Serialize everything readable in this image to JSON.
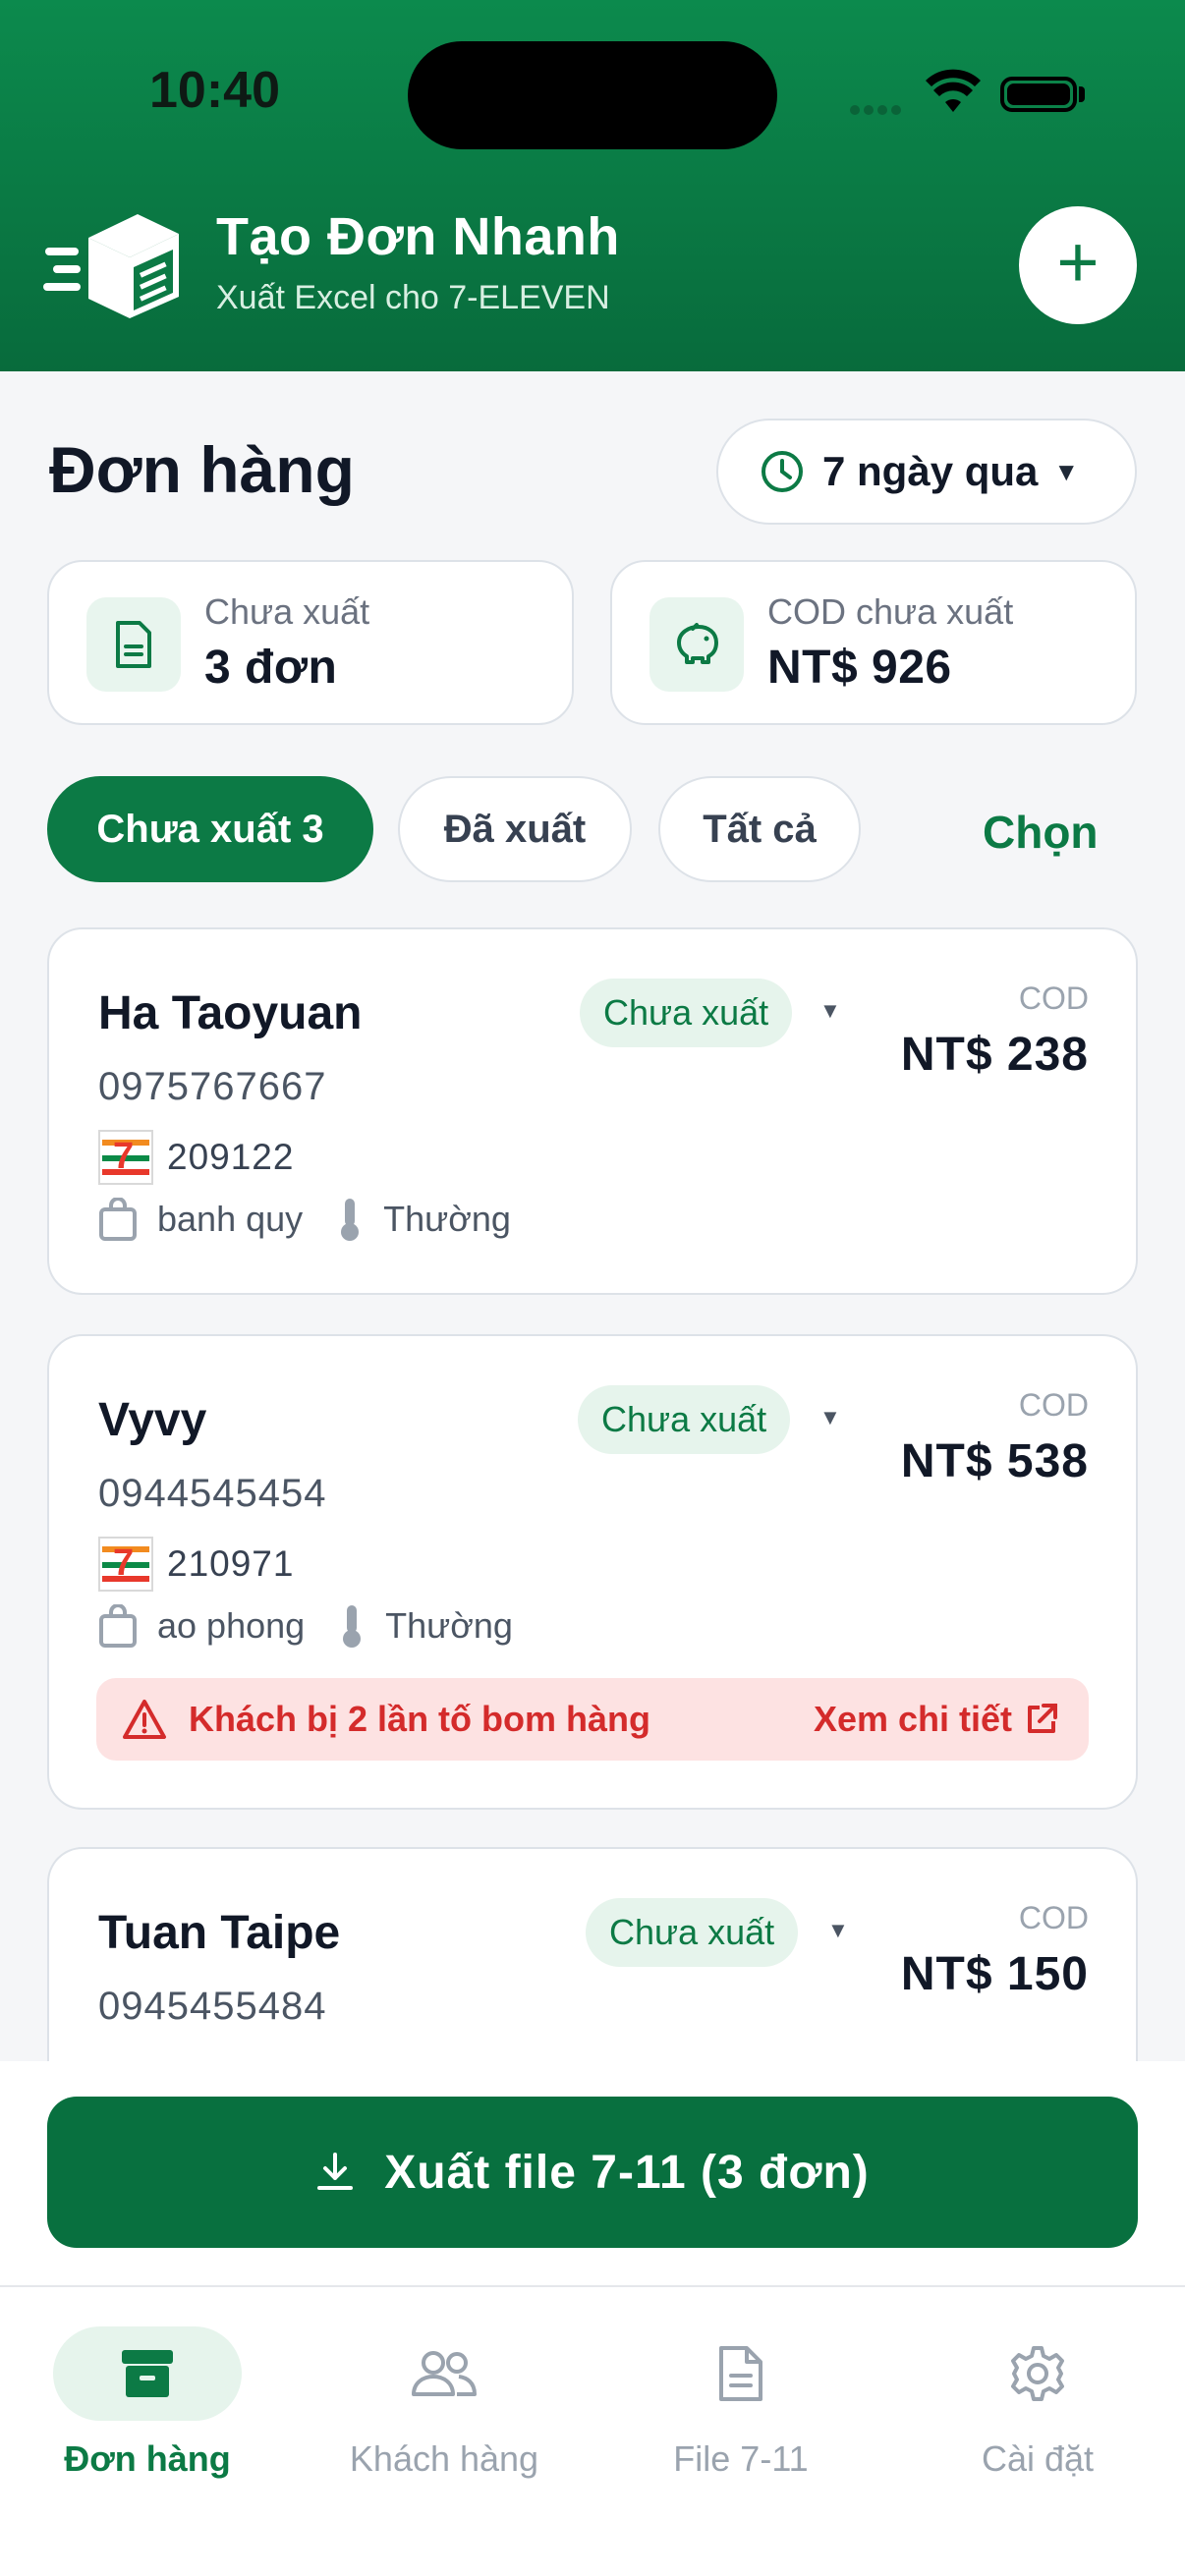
{
  "status_bar": {
    "time": "10:40"
  },
  "header": {
    "title": "Tạo Đơn Nhanh",
    "subtitle": "Xuất Excel cho 7-ELEVEN",
    "add_icon": "plus-icon",
    "brand_icon": "box-delivery-icon"
  },
  "page": {
    "title": "Đơn hàng",
    "range_label": "7 ngày qua",
    "range_icon": "clock-icon"
  },
  "stats": [
    {
      "label": "Chưa xuất",
      "value": "3 đơn",
      "icon": "document-icon"
    },
    {
      "label": "COD chưa xuất",
      "value": "NT$ 926",
      "icon": "piggy-bank-icon"
    }
  ],
  "tabs": [
    {
      "label": "Chưa xuất 3",
      "active": true
    },
    {
      "label": "Đã xuất",
      "active": false
    },
    {
      "label": "Tất cả",
      "active": false
    }
  ],
  "choose_label": "Chọn",
  "orders": [
    {
      "name": "Ha Taoyuan",
      "phone": "0975767667",
      "store": "209122",
      "item": "banh quy",
      "temp": "Thường",
      "status": "Chưa xuất",
      "cod_label": "COD",
      "cod": "NT$ 238"
    },
    {
      "name": "Vyvy",
      "phone": "0944545454",
      "store": "210971",
      "item": "ao phong",
      "temp": "Thường",
      "status": "Chưa xuất",
      "cod_label": "COD",
      "cod": "NT$ 538",
      "warning": "Khách bị 2 lần tố bom hàng",
      "warning_link": "Xem chi tiết"
    },
    {
      "name": "Tuan Taipe",
      "phone": "0945455484",
      "status": "Chưa xuất",
      "cod_label": "COD",
      "cod": "NT$ 150"
    }
  ],
  "export_button": "Xuất file 7-11 (3 đơn)",
  "nav": [
    {
      "label": "Đơn hàng",
      "icon": "archive-box-icon",
      "active": true
    },
    {
      "label": "Khách hàng",
      "icon": "users-icon",
      "active": false
    },
    {
      "label": "File 7-11",
      "icon": "file-icon",
      "active": false
    },
    {
      "label": "Cài đặt",
      "icon": "gear-icon",
      "active": false
    }
  ],
  "colors": {
    "brand": "#0c7a45",
    "danger": "#d42b2b",
    "badge_bg": "#e6f4ec"
  }
}
